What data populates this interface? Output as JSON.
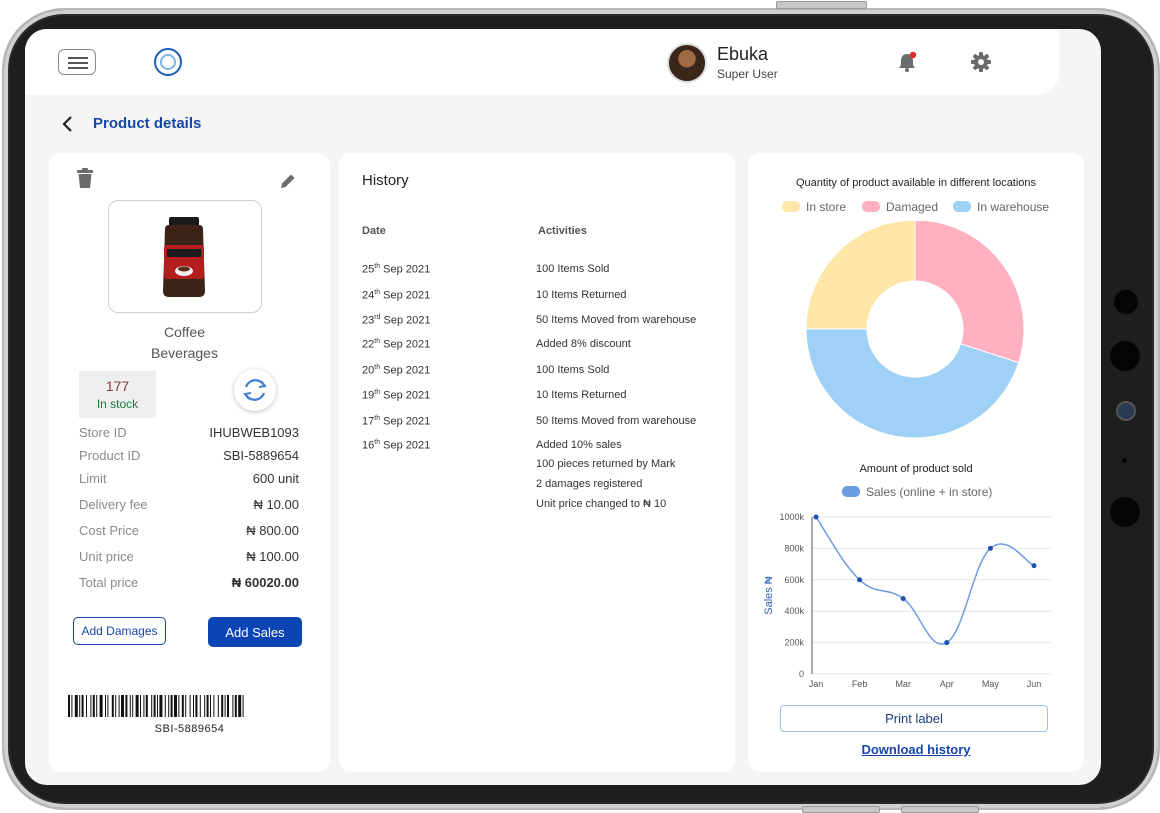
{
  "header": {
    "user_name": "Ebuka",
    "user_role": "Super User",
    "icons": [
      "menu-icon",
      "logo-icon",
      "bell-icon",
      "gear-icon"
    ],
    "notification_dot_color": "#d92b2b"
  },
  "page": {
    "title": "Product details"
  },
  "product": {
    "name": "Coffee",
    "category": "Beverages",
    "stock_count": "177",
    "stock_label": "In stock",
    "details": [
      {
        "label": "Store ID",
        "value": "IHUBWEB1093"
      },
      {
        "label": "Product ID",
        "value": "SBI-5889654"
      },
      {
        "label": "Limit",
        "value": "600 unit"
      },
      {
        "label": "Delivery fee",
        "value": "₦ 10.00"
      },
      {
        "label": "Cost Price",
        "value": "₦ 800.00"
      },
      {
        "label": "Unit price",
        "value": "₦ 100.00"
      },
      {
        "label": "Total price",
        "value": "₦ 60020.00"
      }
    ],
    "add_damages_label": "Add Damages",
    "add_sales_label": "Add Sales",
    "barcode_text": "SBI-5889654"
  },
  "history": {
    "title": "History",
    "date_header": "Date",
    "activity_header": "Activities",
    "rows": [
      {
        "day": "25",
        "suffix": "th",
        "rest": " Sep 2021",
        "activity": "100 Items Sold"
      },
      {
        "day": "24",
        "suffix": "th",
        "rest": " Sep 2021",
        "activity": "10 Items Returned"
      },
      {
        "day": "23",
        "suffix": "rd",
        "rest": " Sep 2021",
        "activity": "50 Items Moved from warehouse"
      },
      {
        "day": "22",
        "suffix": "th",
        "rest": " Sep 2021",
        "activity": "Added 8% discount"
      },
      {
        "day": "20",
        "suffix": "th",
        "rest": " Sep 2021",
        "activity": "100 Items Sold"
      },
      {
        "day": "19",
        "suffix": "th",
        "rest": " Sep 2021",
        "activity": "10 Items Returned"
      },
      {
        "day": "17",
        "suffix": "th",
        "rest": " Sep 2021",
        "activity": "50 Items Moved from warehouse"
      },
      {
        "day": "16",
        "suffix": "th",
        "rest": " Sep 2021",
        "activity": "Added 10% sales"
      }
    ],
    "extra_activities": [
      "100 pieces returned by Mark",
      "2 damages registered",
      "Unit price changed to ₦ 10"
    ]
  },
  "actions": {
    "print_label": "Print label",
    "download_history": "Download history"
  },
  "chart_data": [
    {
      "type": "pie",
      "subtype": "doughnut",
      "title": "Quantity of product available in different locations",
      "legend_position": "top",
      "slices": [
        {
          "label": "In store",
          "value": 25,
          "color": "#fde6a6"
        },
        {
          "label": "Damaged",
          "value": 30,
          "color": "#ffb1c1"
        },
        {
          "label": "In warehouse",
          "value": 45,
          "color": "#9fd0f5"
        }
      ]
    },
    {
      "type": "line",
      "title": "Amount of product sold",
      "legend_position": "top",
      "series": [
        {
          "name": "Sales (online + in store)",
          "color": "#6b9be0",
          "values": [
            1000000,
            600000,
            480000,
            200000,
            800000,
            690000
          ]
        }
      ],
      "categories": [
        "Jan",
        "Feb",
        "Mar",
        "Apr",
        "May",
        "Jun"
      ],
      "ylabel": "Sales ₦",
      "ylim": [
        0,
        1000000
      ],
      "yticks": [
        "0",
        "200k",
        "400k",
        "600k",
        "800k",
        "1000k"
      ],
      "grid": true,
      "smooth": true
    }
  ]
}
